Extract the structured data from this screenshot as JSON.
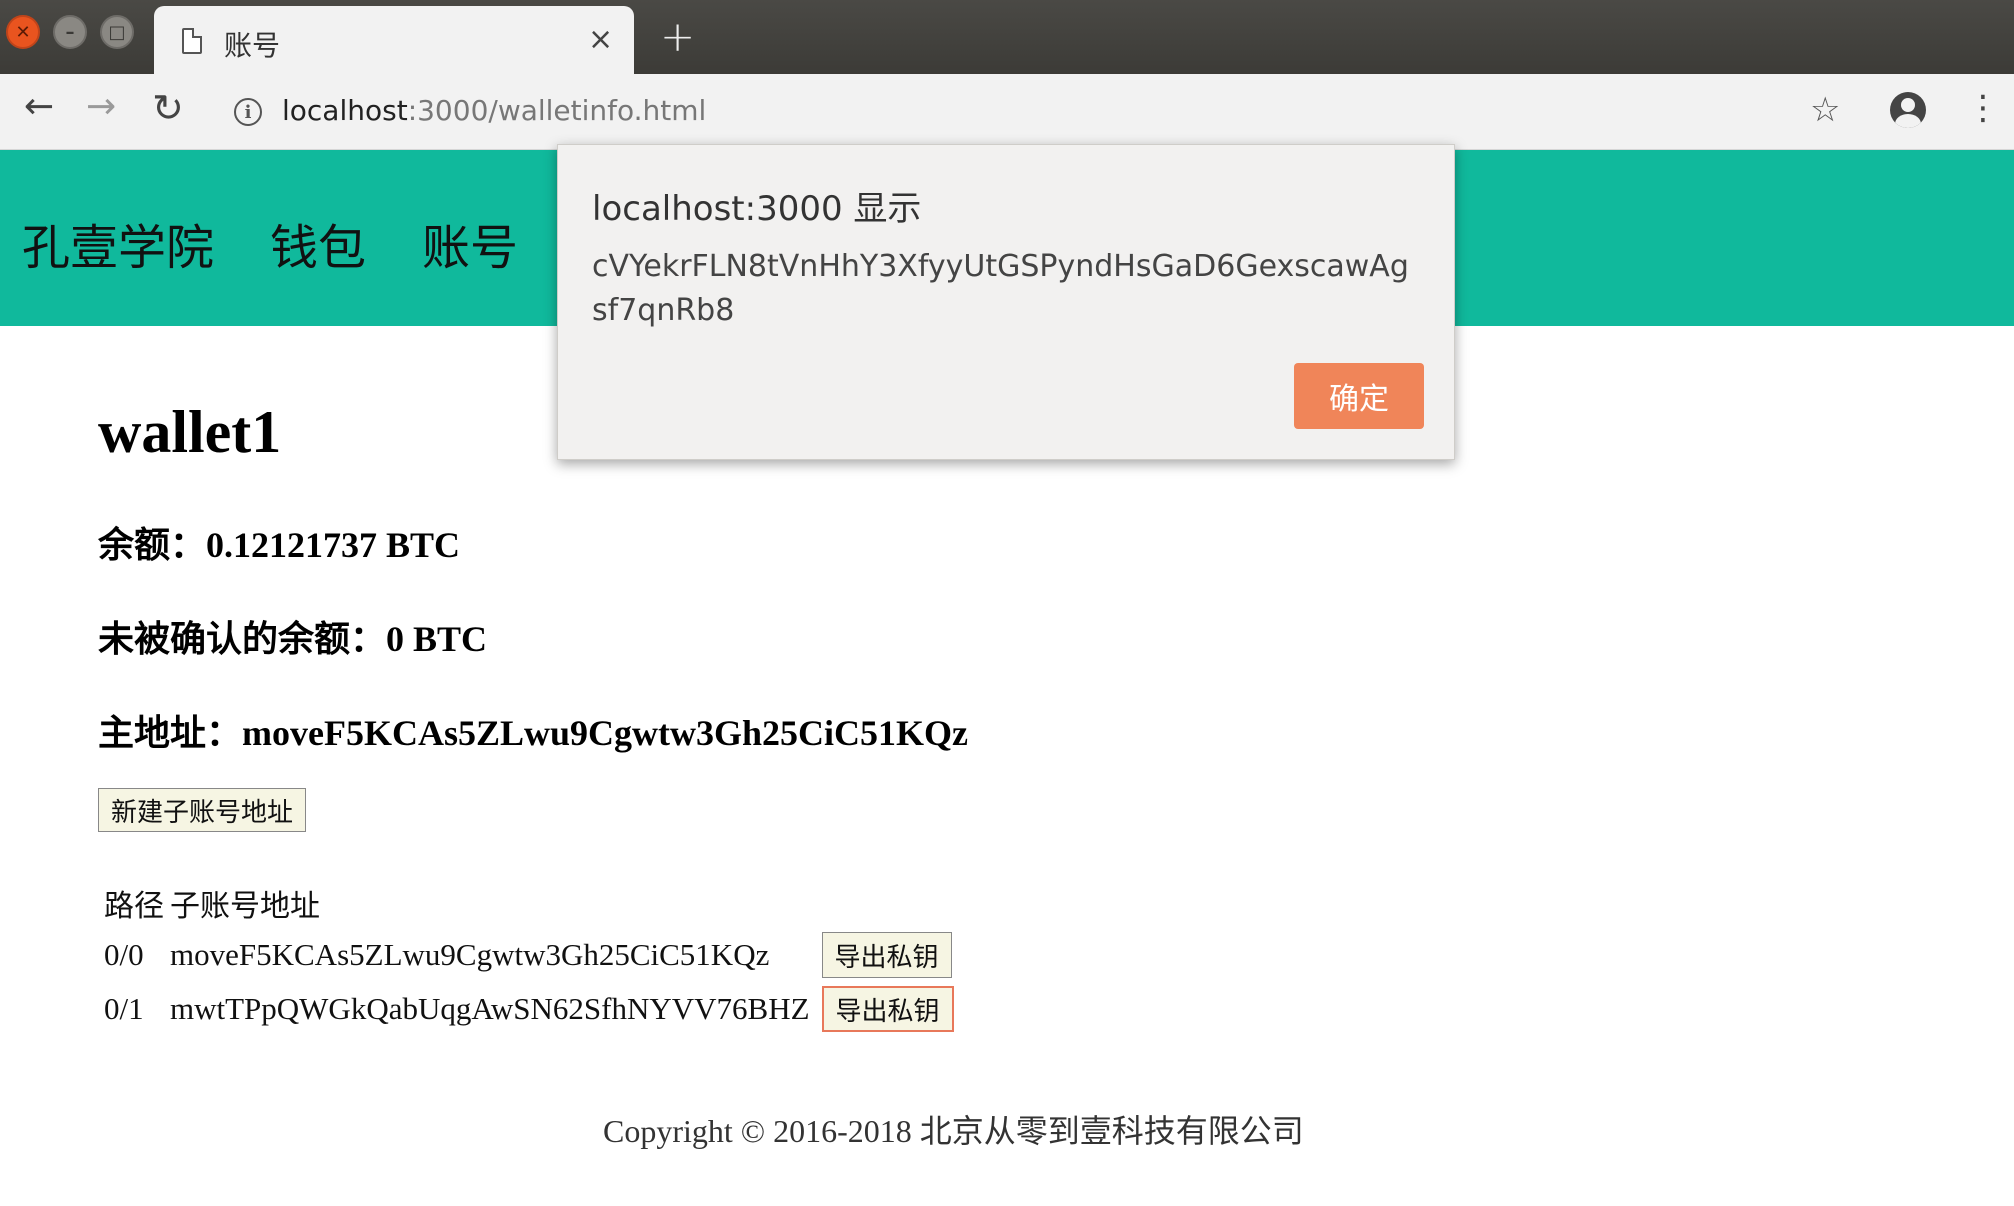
{
  "browser": {
    "tab_title": "账号",
    "tab_close": "×",
    "new_tab": "+",
    "url_host": "localhost",
    "url_rest": ":3000/walletinfo.html"
  },
  "header": {
    "nav": [
      "孔壹学院",
      "钱包",
      "账号"
    ]
  },
  "wallet": {
    "name": "wallet1",
    "balance": "余额：0.12121737 BTC",
    "unconfirmed": "未被确认的余额：0 BTC",
    "main_address": "主地址：moveF5KCAs5ZLwu9Cgwtw3Gh25CiC51KQz",
    "new_sub_button": "新建子账号地址"
  },
  "table": {
    "headers": [
      "路径",
      "子账号地址"
    ],
    "rows": [
      {
        "path": "0/0",
        "address": "moveF5KCAs5ZLwu9Cgwtw3Gh25CiC51KQz",
        "button": "导出私钥"
      },
      {
        "path": "0/1",
        "address": "mwtTPpQWGkQabUqgAwSN62SfhNYVV76BHZ",
        "button": "导出私钥"
      }
    ]
  },
  "footer": {
    "copyright": "Copyright © 2016-2018 北京从零到壹科技有限公司"
  },
  "dialog": {
    "title": "localhost:3000 显示",
    "message": "cVYekrFLN8tVnHhY3XfyyUtGSPyndHsGaD6GexscawAgsf7qnRb8",
    "ok": "确定"
  },
  "colors": {
    "header_bg": "#10b99c",
    "dialog_button": "#f08559"
  }
}
